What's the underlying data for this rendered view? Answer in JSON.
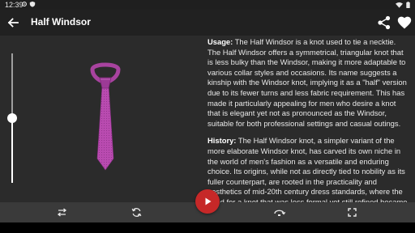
{
  "status_bar": {
    "time": "12:39"
  },
  "app_bar": {
    "title": "Half Windsor"
  },
  "description": {
    "usage_heading": "Usage:",
    "usage_text": "The Half Windsor is a knot used to tie a necktie. The Half Windsor offers a symmetrical, triangular knot that is less bulky than the Windsor, making it more adaptable to various collar styles and occasions. Its name suggests a kinship with the Windsor knot, implying it as a \"half\" version due to its fewer turns and less fabric requirement. This has made it particularly appealing for men who desire a knot that is elegant yet not as pronounced as the Windsor, suitable for both professional settings and casual outings.",
    "history_heading": "History:",
    "history_text": "The Half Windsor knot, a simpler variant of the more elaborate Windsor knot, has carved its own niche in the world of men's fashion as a versatile and enduring choice. Its origins, while not as directly tied to nobility as its fuller counterpart, are rooted in the practicality and aesthetics of mid-20th century dress standards, where the need for a knot that was less formal yet still refined became apparent."
  },
  "slider": {
    "level": 0.5
  },
  "colors": {
    "tie": "#b94bb0",
    "play": "#c62828"
  },
  "icons": {
    "back": "arrow-left-icon",
    "share": "share-icon",
    "favorite": "heart-icon",
    "swap": "swap-icon",
    "repeat": "repeat-icon",
    "mirror": "flip-icon",
    "fullscreen": "fullscreen-icon",
    "play": "play-icon"
  }
}
